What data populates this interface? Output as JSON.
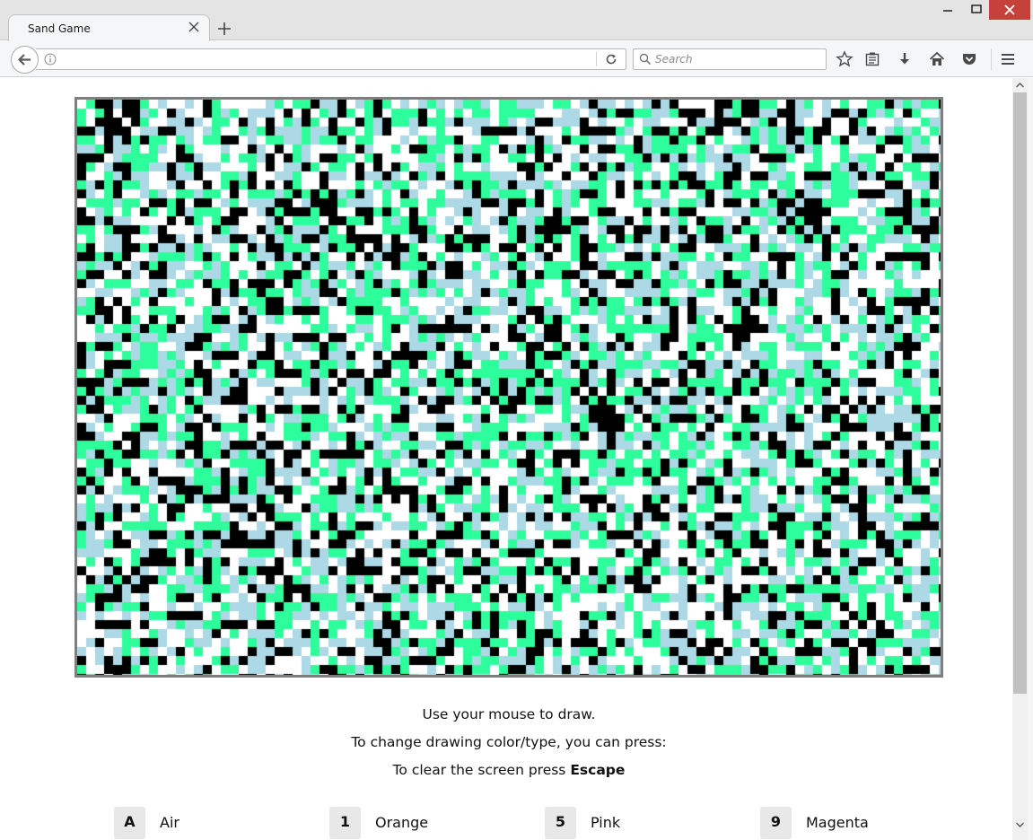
{
  "browser": {
    "tab_title": "Sand Game",
    "url": "",
    "search_placeholder": "Search",
    "icons": [
      "back-arrow-icon",
      "info-icon",
      "reload-icon",
      "search-icon",
      "bookmark-star-icon",
      "reading-list-icon",
      "download-icon",
      "home-icon",
      "pocket-icon",
      "menu-icon"
    ]
  },
  "game": {
    "palette": {
      "white": "#ffffff",
      "light_blue": "#add8e6",
      "green": "#2efd9b",
      "black": "#000000"
    },
    "border_color": "#7f7f7f"
  },
  "instructions": {
    "line1": "Use your mouse to draw.",
    "line2": "To change drawing color/type, you can press:",
    "line3_prefix": "To clear the screen press ",
    "line3_key": "Escape"
  },
  "keys": [
    {
      "key": "A",
      "label": "Air"
    },
    {
      "key": "1",
      "label": "Orange"
    },
    {
      "key": "5",
      "label": "Pink"
    },
    {
      "key": "9",
      "label": "Magenta"
    }
  ]
}
